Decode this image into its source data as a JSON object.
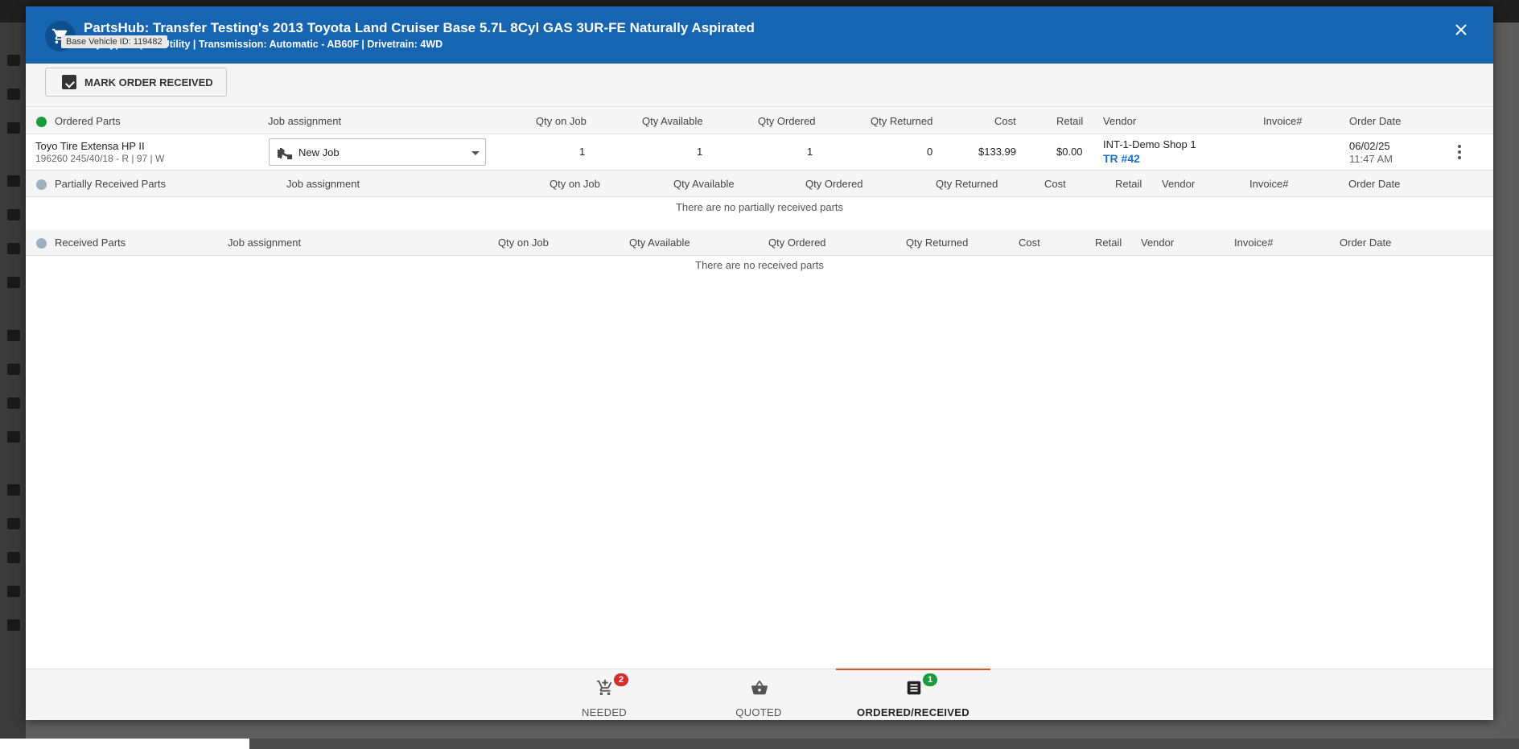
{
  "modal": {
    "title": "PartsHub: Transfer Testing's 2013 Toyota Land Cruiser Base 5.7L 8Cyl GAS 3UR-FE Naturally Aspirated",
    "subtitle": "ody Type:  Sport Utility | Transmission: Automatic - AB60F | Drivetrain: 4WD",
    "tooltip": "Base Vehicle ID: 119482"
  },
  "toolbar": {
    "mark_received_label": "MARK ORDER RECEIVED"
  },
  "ordered": {
    "header": {
      "title": "Ordered Parts",
      "job": "Job assignment",
      "qty_on_job": "Qty on Job",
      "qty_available": "Qty Available",
      "qty_ordered": "Qty Ordered",
      "qty_returned": "Qty Returned",
      "cost": "Cost",
      "retail": "Retail",
      "vendor": "Vendor",
      "invoice": "Invoice#",
      "order_date": "Order Date"
    },
    "rows": [
      {
        "name": "Toyo Tire Extensa HP II",
        "desc": "196260 245/40/18 - R | 97 | W",
        "job": "New Job",
        "qty_on_job": "1",
        "qty_available": "1",
        "qty_ordered": "1",
        "qty_returned": "0",
        "cost": "$133.99",
        "retail": "$0.00",
        "vendor": "INT-1-Demo Shop 1",
        "tr": "TR #42",
        "invoice": "",
        "date": "06/02/25",
        "time": "11:47 AM"
      }
    ]
  },
  "partial": {
    "header": {
      "title": "Partially Received Parts",
      "job": "Job assignment",
      "qty_on_job": "Qty on Job",
      "qty_available": "Qty Available",
      "qty_ordered": "Qty Ordered",
      "qty_returned": "Qty Returned",
      "cost": "Cost",
      "retail": "Retail",
      "vendor": "Vendor",
      "invoice": "Invoice#",
      "order_date": "Order Date"
    },
    "empty": "There are no partially received parts"
  },
  "received": {
    "header": {
      "title": "Received Parts",
      "job": "Job assignment",
      "qty_on_job": "Qty on Job",
      "qty_available": "Qty Available",
      "qty_ordered": "Qty Ordered",
      "qty_returned": "Qty Returned",
      "cost": "Cost",
      "retail": "Retail",
      "vendor": "Vendor",
      "invoice": "Invoice#",
      "order_date": "Order Date"
    },
    "empty": "There are no received parts"
  },
  "footer": {
    "tabs": [
      {
        "label": "NEEDED",
        "badge": "2",
        "icon": "cart-plus-icon"
      },
      {
        "label": "QUOTED",
        "badge": "",
        "icon": "basket-icon"
      },
      {
        "label": "ORDERED/RECEIVED",
        "badge": "1",
        "icon": "receipt-icon"
      }
    ]
  },
  "colors": {
    "header_blue": "#1565b0",
    "accent_orange": "#e0501b",
    "status_green": "#1a9b3d",
    "badge_red": "#d32f2f",
    "link_blue": "#1a73c8"
  }
}
